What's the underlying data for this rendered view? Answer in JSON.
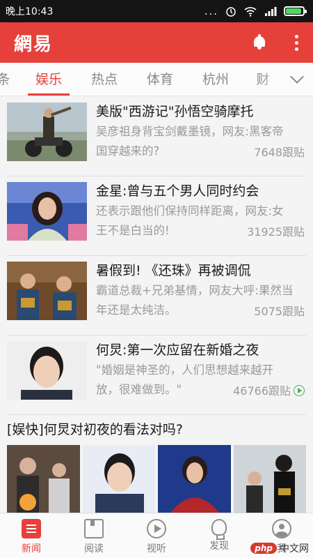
{
  "status_bar": {
    "time": "晚上10:43",
    "dots": "...",
    "battery_level": 0.9
  },
  "header": {
    "logo": "網易",
    "icons": [
      "bell-icon",
      "more-vertical-icon"
    ]
  },
  "tabs": [
    {
      "label": "条"
    },
    {
      "label": "娱乐",
      "active": true
    },
    {
      "label": "热点"
    },
    {
      "label": "体育"
    },
    {
      "label": "杭州"
    },
    {
      "label": "财"
    }
  ],
  "news": [
    {
      "title": "美版\"西游记\"孙悟空骑摩托",
      "digest_line1": "吴彦祖身背宝剑戴墨镜，网友:黑客帝",
      "digest_line2": "国穿越来的?",
      "count": "7648跟贴"
    },
    {
      "title": "金星:曾与五个男人同时约会",
      "digest_line1": "还表示跟他们保持同样距离，网友:女",
      "digest_line2": "王不是白当的!",
      "count": "31925跟贴"
    },
    {
      "title": "暑假到! 《还珠》再被调侃",
      "digest_line1": "霸道总裁+兄弟基情，网友大呼:果然当",
      "digest_line2": "年还是太纯洁。",
      "count": "5075跟贴"
    },
    {
      "title": "何炅:第一次应留在新婚之夜",
      "digest_line1": "\"婚姻是神圣的，人们思想越来越开",
      "digest_line2": "放，很难做到。\"",
      "count": "46766跟贴",
      "video_icon": "video-play-icon"
    }
  ],
  "photoset": {
    "title": "[娱快]何炅对初夜的看法对吗?"
  },
  "bottom_nav": [
    {
      "label": "新闻",
      "icon": "news-icon",
      "active": true
    },
    {
      "label": "阅读",
      "icon": "reading-icon"
    },
    {
      "label": "视听",
      "icon": "play-icon"
    },
    {
      "label": "发现",
      "icon": "bulb-icon"
    },
    {
      "label": "我",
      "icon": "user-icon"
    }
  ],
  "watermark": {
    "brand": "php",
    "text": "中文网"
  },
  "colors": {
    "brand_red": "#e6403a",
    "status_bar": "#141414",
    "battery_green": "#4cd964"
  }
}
